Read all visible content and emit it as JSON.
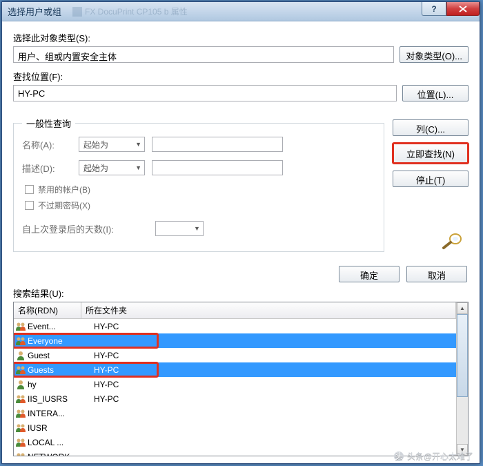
{
  "titlebar": {
    "title": "选择用户或组"
  },
  "section1": {
    "label": "选择此对象类型(S):",
    "value": "用户、组或内置安全主体",
    "button": "对象类型(O)..."
  },
  "section2": {
    "label": "查找位置(F):",
    "value": "HY-PC",
    "button": "位置(L)..."
  },
  "group": {
    "legend": "一般性查询",
    "name_label": "名称(A):",
    "name_combo": "起始为",
    "desc_label": "描述(D):",
    "desc_combo": "起始为",
    "cb1": "禁用的帐户(B)",
    "cb2": "不过期密码(X)",
    "days_label": "自上次登录后的天数(I):"
  },
  "side": {
    "columns": "列(C)...",
    "findnow": "立即查找(N)",
    "stop": "停止(T)"
  },
  "okrow": {
    "ok": "确定",
    "cancel": "取消"
  },
  "results": {
    "label": "搜索结果(U):",
    "col1": "名称(RDN)",
    "col2": "所在文件夹",
    "rows": [
      {
        "name": "Event...",
        "folder": "HY-PC",
        "type": "group"
      },
      {
        "name": "Everyone",
        "folder": "",
        "type": "group",
        "selected": true,
        "box": true
      },
      {
        "name": "Guest",
        "folder": "HY-PC",
        "type": "user"
      },
      {
        "name": "Guests",
        "folder": "HY-PC",
        "type": "group",
        "selected": true,
        "box": true
      },
      {
        "name": "hy",
        "folder": "HY-PC",
        "type": "user"
      },
      {
        "name": "IIS_IUSRS",
        "folder": "HY-PC",
        "type": "group"
      },
      {
        "name": "INTERA...",
        "folder": "",
        "type": "group"
      },
      {
        "name": "IUSR",
        "folder": "",
        "type": "group"
      },
      {
        "name": "LOCAL ...",
        "folder": "",
        "type": "group"
      },
      {
        "name": "NETWORK",
        "folder": "",
        "type": "group"
      }
    ]
  },
  "watermark": "头条@开心太难了"
}
